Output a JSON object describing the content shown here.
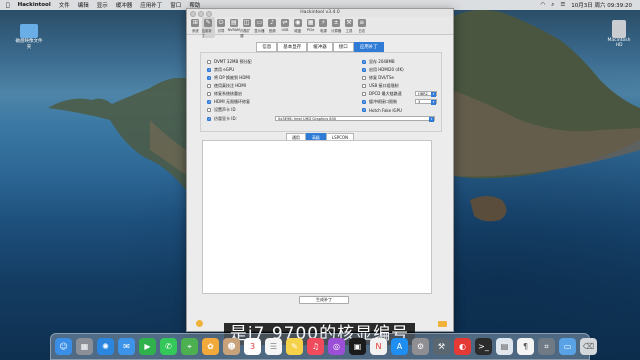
{
  "menubar": {
    "apple_icon": "apple-icon",
    "app_name": "Hackintool",
    "items": [
      "文件",
      "编辑",
      "显示",
      "缓冲器",
      "应用补丁",
      "窗口",
      "帮助"
    ],
    "clock": "10月3日 周六  09:39:20"
  },
  "desktop": {
    "folder_label": "磁盘映像文件夹",
    "disk_label": "Macintosh HD"
  },
  "window": {
    "title": "Hackintool v3.4.0",
    "toolbar": [
      {
        "label": "系统",
        "icon": "system-icon"
      },
      {
        "label": "应用补丁",
        "icon": "patch-icon"
      },
      {
        "label": "引导",
        "icon": "boot-icon"
      },
      {
        "label": "NVRAM",
        "icon": "nvram-icon"
      },
      {
        "label": "内核扩展",
        "icon": "kext-icon"
      },
      {
        "label": "显示器",
        "icon": "display-icon"
      },
      {
        "label": "音频",
        "icon": "audio-icon"
      },
      {
        "label": "USB",
        "icon": "usb-icon"
      },
      {
        "label": "磁盘",
        "icon": "disk-icon"
      },
      {
        "label": "PCIe",
        "icon": "pcie-icon"
      },
      {
        "label": "电源",
        "icon": "power-icon"
      },
      {
        "label": "计算器",
        "icon": "calculator-icon"
      },
      {
        "label": "工具",
        "icon": "tools-icon"
      },
      {
        "label": "日志",
        "icon": "log-icon"
      }
    ],
    "tabs": [
      "信息",
      "基本显存",
      "缓冲器",
      "接口",
      "应用补丁"
    ],
    "options_left": [
      {
        "label": "DVMT 32MB 预分配",
        "checked": false
      },
      {
        "label": "禁用 eGPU",
        "checked": true
      },
      {
        "label": "将 DP 换被到 HDMI",
        "checked": true
      },
      {
        "label": "使用真技注 HDMI",
        "checked": false
      },
      {
        "label": "修复系统核重启",
        "checked": false
      },
      {
        "label": "HDMI 无限循环修复",
        "checked": true
      },
      {
        "label": "设置声卡 ID",
        "checked": false
      },
      {
        "label": "仿冒显卡 ID:",
        "checked": true
      }
    ],
    "options_right": [
      {
        "label": "显存 2048MB",
        "checked": true
      },
      {
        "label": "启用 HDMI20 (4K)",
        "checked": true
      },
      {
        "label": "修复 DVI/TSe",
        "checked": false
      },
      {
        "label": "USB 接口组限制",
        "checked": false
      },
      {
        "label": "DPCD 最大链路速",
        "checked": false
      },
      {
        "label": "缓冲帧接口限制",
        "checked": true
      },
      {
        "label": "Hotch Fake IGPU",
        "checked": true
      }
    ],
    "dpcd_value": "HBR2",
    "port_limit_value": "3",
    "spoof_device_value": "0x3E98: Intel UHD Graphics 630",
    "subtabs": [
      "通用",
      "高级",
      "LSPCON"
    ],
    "generate_button": "生成补丁"
  },
  "subtitle": "是i7 9700的核显编号",
  "dock": [
    {
      "icon": "finder-icon",
      "color": "#3a8ee6"
    },
    {
      "icon": "launchpad-icon",
      "color": "#8a8f98"
    },
    {
      "icon": "safari-icon",
      "color": "#2b86e0"
    },
    {
      "icon": "mail-icon",
      "color": "#3d93e8"
    },
    {
      "icon": "facetime-icon",
      "color": "#2fb24b"
    },
    {
      "icon": "messages-icon",
      "color": "#34c759"
    },
    {
      "icon": "maps-icon",
      "color": "#4caf50"
    },
    {
      "icon": "photos-icon",
      "color": "#f2a93b"
    },
    {
      "icon": "contacts-icon",
      "color": "#c7a27a"
    },
    {
      "icon": "calendar-icon",
      "color": "#ffffff"
    },
    {
      "icon": "reminders-icon",
      "color": "#f5f5f5"
    },
    {
      "icon": "notes-icon",
      "color": "#f6d24a"
    },
    {
      "icon": "music-icon",
      "color": "#f04b5c"
    },
    {
      "icon": "podcasts-icon",
      "color": "#9b4fd6"
    },
    {
      "icon": "tv-icon",
      "color": "#1b1b1b"
    },
    {
      "icon": "news-icon",
      "color": "#f1f1f1"
    },
    {
      "icon": "appstore-icon",
      "color": "#1f8ef1"
    },
    {
      "icon": "settings-icon",
      "color": "#8e8e93"
    },
    {
      "icon": "hackintool-icon",
      "color": "#5b6770"
    },
    {
      "icon": "video-app-icon",
      "color": "#e53935"
    },
    {
      "icon": "terminal-icon",
      "color": "#2b2b2b"
    },
    {
      "icon": "preview-icon",
      "color": "#dfe6ee"
    },
    {
      "icon": "textedit-icon",
      "color": "#f4f4f4"
    },
    {
      "icon": "screenshot-icon",
      "color": "#707a84"
    },
    {
      "icon": "folder-icon",
      "color": "#5aa2e6"
    },
    {
      "icon": "trash-icon",
      "color": "#d5d8db"
    }
  ]
}
